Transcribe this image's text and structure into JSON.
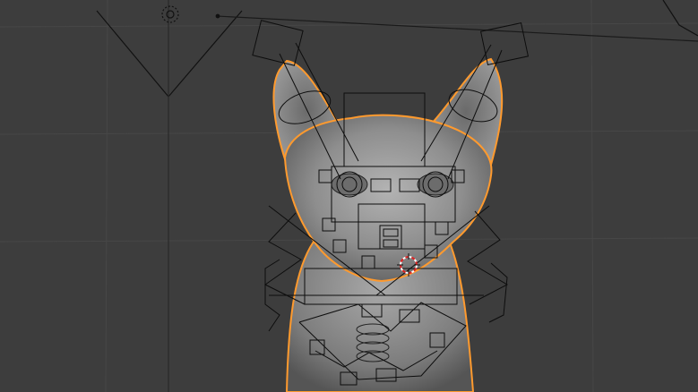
{
  "viewport": {
    "background": "#3d3d3d",
    "grid_color": "#474747",
    "camera_color": "#111111",
    "rig_color": "#0d0d0d"
  },
  "selected_object": {
    "outline_color": "#ff9a2e",
    "mesh_color": "#8a8a8a"
  },
  "scene_objects": {
    "camera": "camera-icon",
    "light": "light-icon",
    "cursor": "3d-cursor-icon",
    "mesh": "sphynx-cat-mesh",
    "armature": "face-rig-armature"
  }
}
